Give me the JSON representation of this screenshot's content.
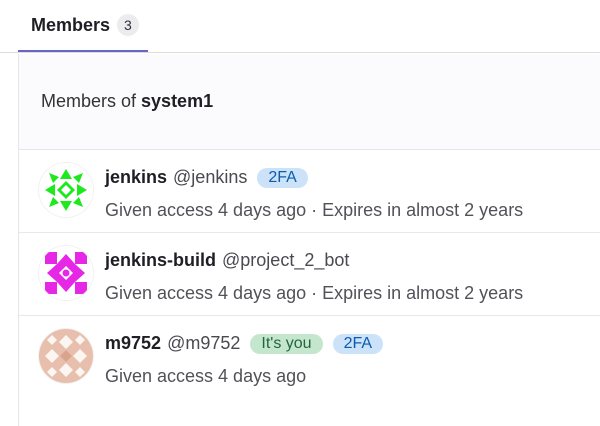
{
  "tabs": [
    {
      "label": "Members",
      "count": "3"
    }
  ],
  "panel": {
    "prefix": "Members of",
    "group": "system1"
  },
  "members": [
    {
      "name": "jenkins",
      "handle": "@jenkins",
      "badges": [
        "2FA"
      ],
      "access": "Given access 4 days ago · Expires in almost 2 years",
      "avatar": {
        "icon": "identicon-green",
        "color": "#1ee81e"
      }
    },
    {
      "name": "jenkins-build",
      "handle": "@project_2_bot",
      "badges": [],
      "access": "Given access 4 days ago · Expires in almost 2 years",
      "avatar": {
        "icon": "identicon-magenta",
        "color": "#e628e6"
      }
    },
    {
      "name": "m9752",
      "handle": "@m9752",
      "badges": [
        "It's you",
        "2FA"
      ],
      "access": "Given access 4 days ago",
      "avatar": {
        "icon": "identicon-peach",
        "color": "#e7bfac"
      }
    }
  ],
  "colors": {
    "tab_underline": "#6666c4",
    "badge_2fa_bg": "#cbe2f9",
    "badge_you_bg": "#c3e6cd"
  }
}
